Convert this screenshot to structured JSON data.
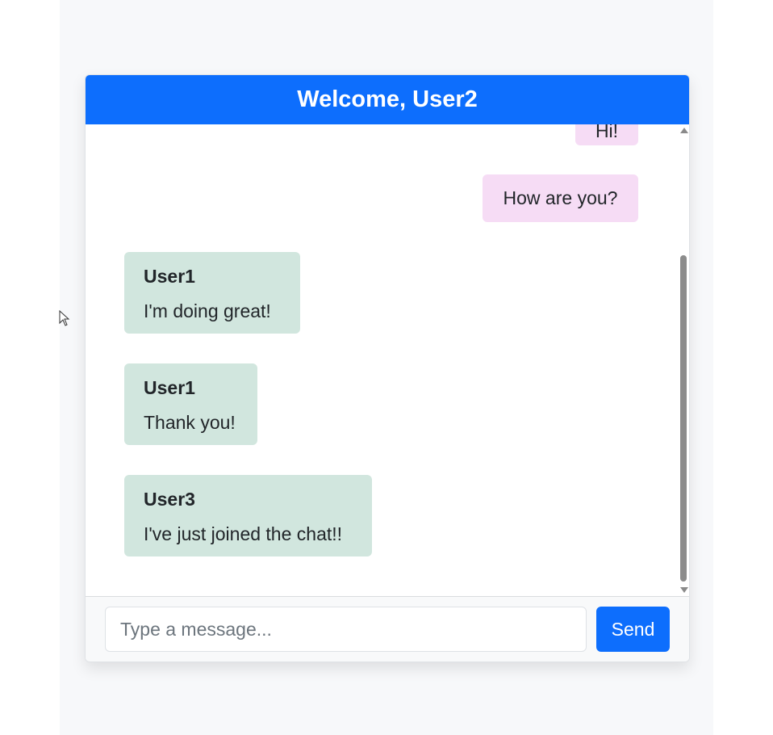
{
  "header": {
    "title": "Welcome, User2"
  },
  "messages": [
    {
      "type": "self",
      "text": "Hi!"
    },
    {
      "type": "self",
      "text": "How are you?"
    },
    {
      "type": "other",
      "sender": "User1",
      "text": "I'm doing great!"
    },
    {
      "type": "other",
      "sender": "User1",
      "text": "Thank you!"
    },
    {
      "type": "other",
      "sender": "User3",
      "text": "I've just joined the chat!!"
    }
  ],
  "composer": {
    "placeholder": "Type a message...",
    "send_label": "Send"
  },
  "colors": {
    "accent": "#0d6efd",
    "self_bubble": "#f6dcf5",
    "other_bubble": "#d1e6de"
  },
  "icons": {
    "cursor": "mouse-pointer-icon",
    "scroll_up": "triangle-up-icon",
    "scroll_down": "triangle-down-icon"
  }
}
